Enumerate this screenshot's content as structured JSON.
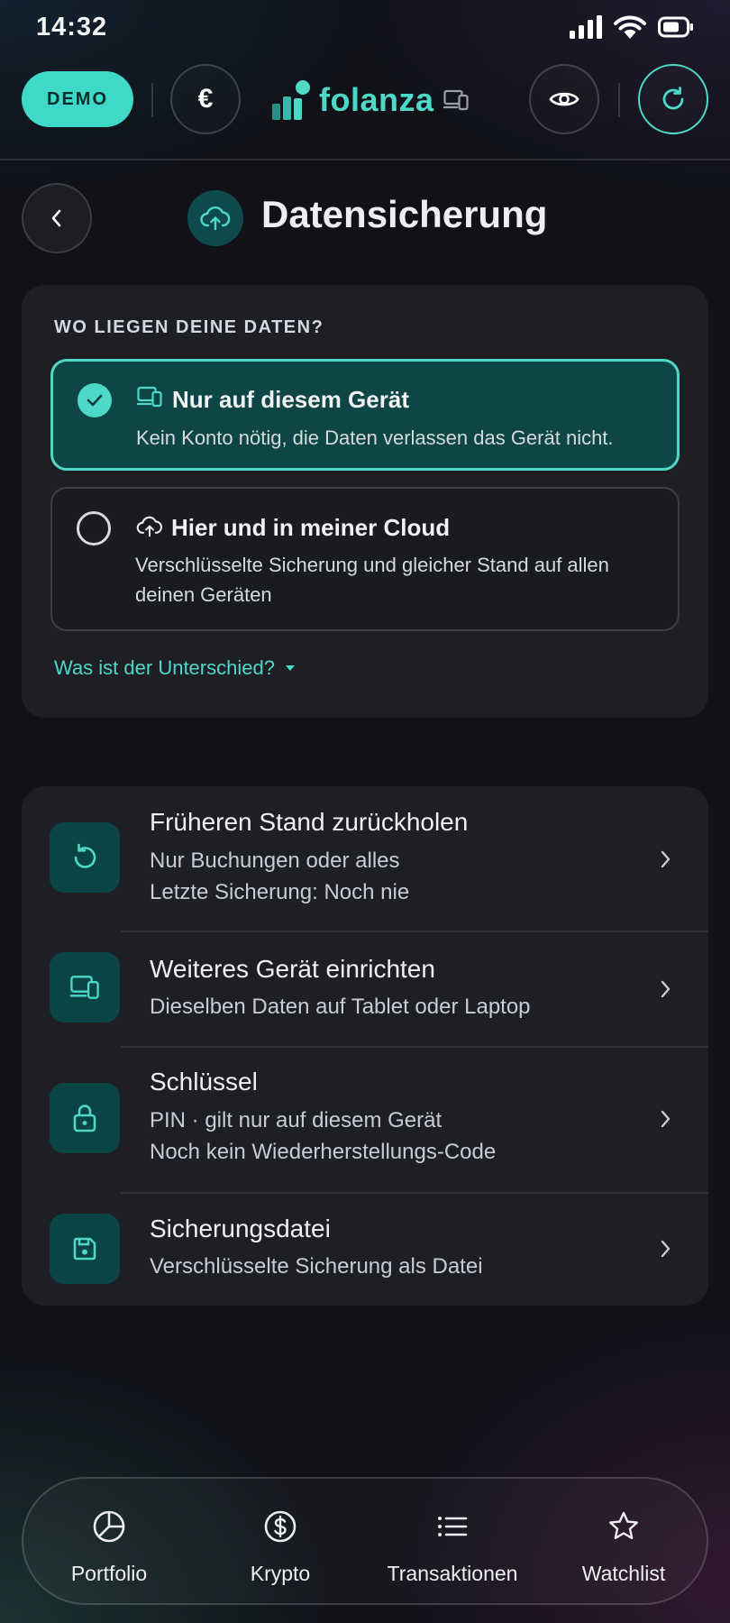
{
  "status_bar": {
    "time": "14:32"
  },
  "top_bar": {
    "demo_label": "DEMO",
    "currency_symbol": "€",
    "brand": "folanza"
  },
  "header": {
    "title": "Datensicherung"
  },
  "storage": {
    "section_label": "WO LIEGEN DEINE DATEN?",
    "options": [
      {
        "title": "Nur auf diesem Gerät",
        "description": "Kein Konto nötig, die Daten verlassen das Gerät nicht.",
        "selected": true,
        "icon": "devices-icon"
      },
      {
        "title": "Hier und in meiner Cloud",
        "description": "Verschlüsselte Sicherung und gleicher Stand auf allen deinen Geräten",
        "selected": false,
        "icon": "cloud-upload-icon"
      }
    ],
    "difference_link": "Was ist der Unterschied?"
  },
  "menu": {
    "items": [
      {
        "title": "Früheren Stand zurückholen",
        "line1": "Nur Buchungen oder alles",
        "line2": "Letzte Sicherung: Noch nie",
        "icon": "restore-icon"
      },
      {
        "title": "Weiteres Gerät einrichten",
        "line1": "Dieselben Daten auf Tablet oder Laptop",
        "icon": "devices-icon"
      },
      {
        "title": "Schlüssel",
        "line1": "PIN · gilt nur auf diesem Gerät",
        "line2": "Noch kein Wiederherstellungs-Code",
        "icon": "lock-icon"
      },
      {
        "title": "Sicherungsdatei",
        "line1": "Verschlüsselte Sicherung als Datei",
        "icon": "save-icon"
      }
    ]
  },
  "bottom_nav": {
    "items": [
      {
        "label": "Portfolio",
        "icon": "pie-chart-icon"
      },
      {
        "label": "Krypto",
        "icon": "dollar-circle-icon"
      },
      {
        "label": "Transaktionen",
        "icon": "list-icon"
      },
      {
        "label": "Watchlist",
        "icon": "star-icon"
      }
    ]
  },
  "colors": {
    "accent": "#4dd8c8",
    "selected_bg": "#0d4645",
    "icon_tile": "#0b4444"
  }
}
